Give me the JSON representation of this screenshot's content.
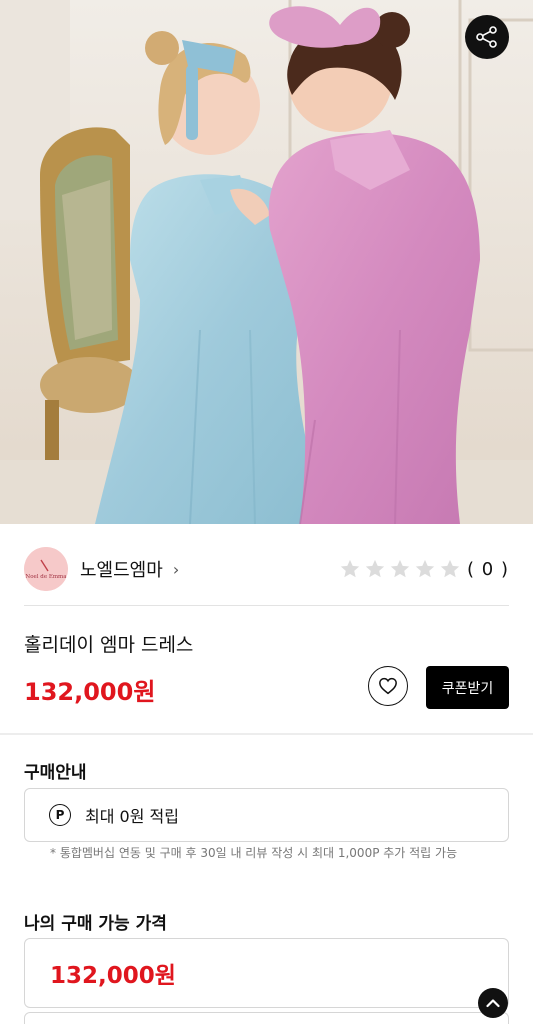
{
  "product": {
    "image_icon": "product-photo",
    "title": "홀리데이 엠마 드레스",
    "price": "132,000원",
    "share_icon": "share-icon"
  },
  "seller": {
    "name": "노엘드엠마",
    "logo_text": "Noel de Emma",
    "chevron": "›"
  },
  "rating": {
    "stars_filled": 0,
    "stars_total": 5,
    "count_text": "( 0 )"
  },
  "actions": {
    "like_icon": "heart-icon",
    "coupon_label": "쿠폰받기"
  },
  "purchase_info": {
    "title": "구매안내",
    "points_icon_label": "P",
    "points_text": "최대 0원 적립",
    "points_note": "* 통합멤버십 연동 및 구매 후 30일 내 리뷰 작성 시 최대 1,000P 추가 적립 가능"
  },
  "available_price": {
    "title": "나의 구매 가능 가격",
    "price": "132,000원"
  },
  "colors": {
    "accent_red": "#e0161e",
    "button_black": "#000000",
    "star_empty": "#dcdcdc",
    "logo_bg": "#f6c9c9"
  },
  "scroll_top_icon": "chevron-up-icon"
}
